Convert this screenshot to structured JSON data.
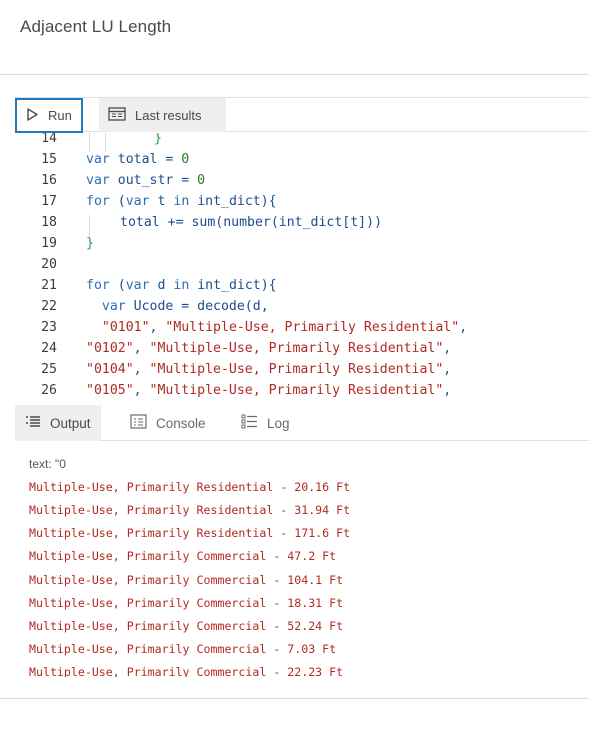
{
  "page": {
    "title": "Adjacent LU Length"
  },
  "toolbar": {
    "run_label": "Run",
    "last_results_label": "Last results"
  },
  "editor": {
    "lines": [
      {
        "n": "14",
        "indent": 2,
        "tokens": [
          {
            "t": "}",
            "c": "br"
          }
        ]
      },
      {
        "n": "15",
        "indent": 0,
        "tokens": [
          {
            "t": "var",
            "c": "kw"
          },
          {
            "t": " total = ",
            "c": ""
          },
          {
            "t": "0",
            "c": "num"
          }
        ]
      },
      {
        "n": "16",
        "indent": 0,
        "tokens": [
          {
            "t": "var",
            "c": "kw"
          },
          {
            "t": " out_str = ",
            "c": ""
          },
          {
            "t": "0",
            "c": "num"
          }
        ]
      },
      {
        "n": "17",
        "indent": 0,
        "tokens": [
          {
            "t": "for",
            "c": "kw"
          },
          {
            "t": " (",
            "c": ""
          },
          {
            "t": "var",
            "c": "kw"
          },
          {
            "t": " t ",
            "c": ""
          },
          {
            "t": "in",
            "c": "kw"
          },
          {
            "t": " int_dict){",
            "c": ""
          }
        ]
      },
      {
        "n": "18",
        "indent": 1,
        "tokens": [
          {
            "t": "total += sum(number(int_dict[t]))",
            "c": ""
          }
        ]
      },
      {
        "n": "19",
        "indent": 0,
        "tokens": [
          {
            "t": "}",
            "c": "br"
          }
        ]
      },
      {
        "n": "20",
        "indent": 0,
        "tokens": []
      },
      {
        "n": "21",
        "indent": 0,
        "tokens": [
          {
            "t": "for",
            "c": "kw"
          },
          {
            "t": " (",
            "c": ""
          },
          {
            "t": "var",
            "c": "kw"
          },
          {
            "t": " d ",
            "c": ""
          },
          {
            "t": "in",
            "c": "kw"
          },
          {
            "t": " int_dict){",
            "c": ""
          }
        ]
      },
      {
        "n": "22",
        "indent": 0,
        "pad": "  ",
        "tokens": [
          {
            "t": "var",
            "c": "kw"
          },
          {
            "t": " Ucode = decode(d,",
            "c": ""
          }
        ]
      },
      {
        "n": "23",
        "indent": 0,
        "pad": "  ",
        "tokens": [
          {
            "t": "\"0101\"",
            "c": "str"
          },
          {
            "t": ", ",
            "c": ""
          },
          {
            "t": "\"Multiple-Use, Primarily Residential\"",
            "c": "str"
          },
          {
            "t": ",",
            "c": ""
          }
        ]
      },
      {
        "n": "24",
        "indent": 0,
        "tokens": [
          {
            "t": "\"0102\"",
            "c": "str"
          },
          {
            "t": ", ",
            "c": ""
          },
          {
            "t": "\"Multiple-Use, Primarily Residential\"",
            "c": "str"
          },
          {
            "t": ",",
            "c": ""
          }
        ]
      },
      {
        "n": "25",
        "indent": 0,
        "tokens": [
          {
            "t": "\"0104\"",
            "c": "str"
          },
          {
            "t": ", ",
            "c": ""
          },
          {
            "t": "\"Multiple-Use, Primarily Residential\"",
            "c": "str"
          },
          {
            "t": ",",
            "c": ""
          }
        ]
      },
      {
        "n": "26",
        "indent": 0,
        "tokens": [
          {
            "t": "\"0105\"",
            "c": "str"
          },
          {
            "t": ", ",
            "c": ""
          },
          {
            "t": "\"Multiple-Use, Primarily Residential\"",
            "c": "str"
          },
          {
            "t": ",",
            "c": ""
          }
        ]
      }
    ]
  },
  "tabs": [
    {
      "label": "Output",
      "icon": "output-list-icon",
      "active": true
    },
    {
      "label": "Console",
      "icon": "console-icon",
      "active": false
    },
    {
      "label": "Log",
      "icon": "log-list-icon",
      "active": false
    }
  ],
  "output": {
    "lines": [
      "text: \"0",
      "Multiple-Use, Primarily Residential - 20.16 Ft",
      "Multiple-Use, Primarily Residential - 31.94 Ft",
      "Multiple-Use, Primarily Residential - 171.6 Ft",
      "Multiple-Use, Primarily Commercial - 47.2 Ft",
      "Multiple-Use, Primarily Commercial - 104.1 Ft",
      "Multiple-Use, Primarily Commercial - 18.31 Ft",
      "Multiple-Use, Primarily Commercial - 52.24 Ft",
      "Multiple-Use, Primarily Commercial - 7.03 Ft",
      "Multiple-Use, Primarily Commercial - 22.23 Ft"
    ]
  },
  "colors": {
    "accent": "#1f7abf",
    "keyword": "#2a6fb5",
    "string": "#b02b24",
    "output_text": "#b32a22"
  }
}
